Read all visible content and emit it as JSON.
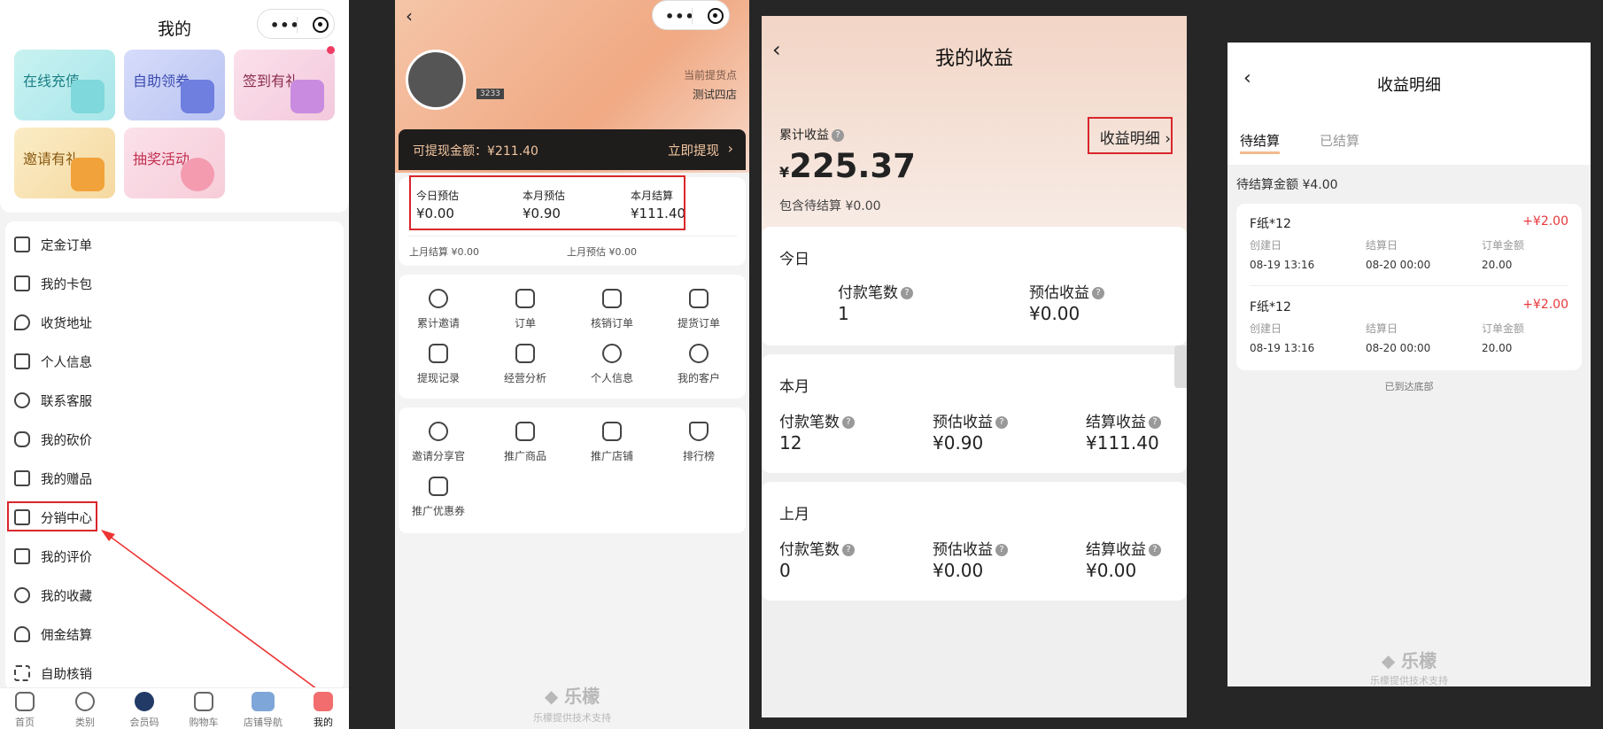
{
  "p1": {
    "title": "我的",
    "tiles": [
      "在线充值",
      "自助领券",
      "签到有礼",
      "邀请有礼",
      "抽奖活动"
    ],
    "menu": [
      "定金订单",
      "我的卡包",
      "收货地址",
      "个人信息",
      "联系客服",
      "我的砍价",
      "我的赠品",
      "分销中心",
      "我的评价",
      "我的收藏",
      "佣金结算",
      "自助核销"
    ],
    "tabs": [
      "首页",
      "类别",
      "会员码",
      "购物车",
      "店铺导航",
      "我的"
    ]
  },
  "p2": {
    "user_id": "3233",
    "store_label": "当前提货点",
    "store_name": "测试四店",
    "withdraw_label": "可提现金额：¥211.40",
    "withdraw_btn": "立即提现",
    "stats": [
      {
        "label": "今日预估",
        "value": "¥0.00"
      },
      {
        "label": "本月预估",
        "value": "¥0.90"
      },
      {
        "label": "本月结算",
        "value": "¥111.40"
      }
    ],
    "last_settle": "上月结算",
    "last_settle_val": "¥0.00",
    "last_est": "上月预估",
    "last_est_val": "¥0.00",
    "grid1": [
      "累计邀请",
      "订单",
      "核销订单",
      "提货订单",
      "提现记录",
      "经营分析",
      "个人信息",
      "我的客户"
    ],
    "grid2": [
      "邀请分享官",
      "推广商品",
      "推广店铺",
      "排行榜",
      "推广优惠券"
    ],
    "brand": "乐檬",
    "brand_sub": "乐檬提供技术支持"
  },
  "p3": {
    "title": "我的收益",
    "total_label": "累计收益",
    "currency": "¥",
    "total": "225.37",
    "pending_label": "包含待结算",
    "pending_val": "¥0.00",
    "detail_link": "收益明细",
    "today": {
      "title": "今日",
      "count_label": "付款笔数",
      "count": "1",
      "est_label": "预估收益",
      "est": "¥0.00"
    },
    "month": {
      "title": "本月",
      "count_label": "付款笔数",
      "count": "12",
      "est_label": "预估收益",
      "est": "¥0.90",
      "settle_label": "结算收益",
      "settle": "¥111.40"
    },
    "last": {
      "title": "上月",
      "count_label": "付款笔数",
      "count": "0",
      "est_label": "预估收益",
      "est": "¥0.00",
      "settle_label": "结算收益",
      "settle": "¥0.00"
    }
  },
  "p4": {
    "title": "收益明细",
    "tab_pending": "待结算",
    "tab_done": "已结算",
    "pending_amount": "待结算金额 ¥4.00",
    "items": [
      {
        "name": "F纸*12",
        "amount": "+¥2.00",
        "c1": "创建日",
        "v1": "08-19 13:16",
        "c2": "结算日",
        "v2": "08-20 00:00",
        "c3": "订单金额",
        "v3": "20.00"
      },
      {
        "name": "F纸*12",
        "amount": "+¥2.00",
        "c1": "创建日",
        "v1": "08-19 13:16",
        "c2": "结算日",
        "v2": "08-20 00:00",
        "c3": "订单金额",
        "v3": "20.00"
      }
    ],
    "end_text": "已到达底部",
    "brand": "乐檬",
    "brand_sub": "乐檬提供技术支持"
  },
  "colors": {
    "accent_red": "#d9262b",
    "dark_bar": "#1f1c1c",
    "peach": "#f0a983"
  }
}
